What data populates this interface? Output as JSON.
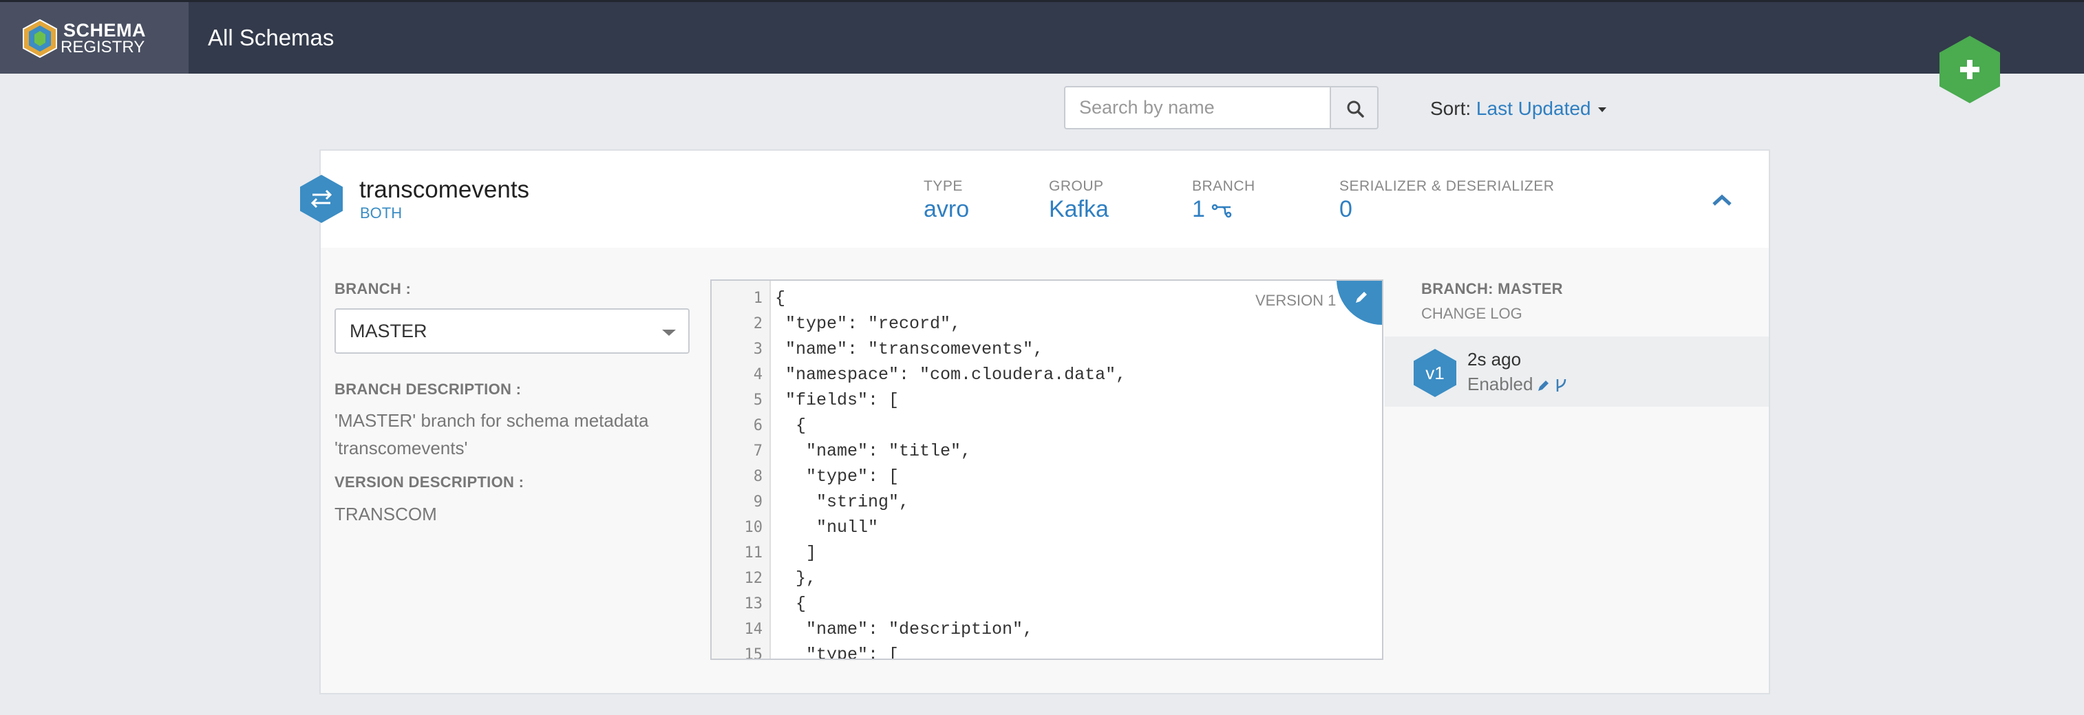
{
  "app": {
    "brand_line1": "SCHEMA",
    "brand_line2": "REGISTRY",
    "page_title": "All Schemas"
  },
  "colors": {
    "topbar": "#333a4b",
    "accent": "#3b8dc4",
    "add_button": "#4aab4f"
  },
  "search": {
    "placeholder": "Search by name",
    "value": ""
  },
  "sort": {
    "label": "Sort:",
    "value": "Last Updated"
  },
  "schema": {
    "name": "transcomevents",
    "compatibility": "BOTH",
    "type_label": "TYPE",
    "type_value": "avro",
    "group_label": "GROUP",
    "group_value": "Kafka",
    "branch_label": "BRANCH",
    "branch_value": "1",
    "serdes_label": "SERIALIZER & DESERIALIZER",
    "serdes_value": "0"
  },
  "left_panel": {
    "branch_label": "BRANCH :",
    "branch_selected": "MASTER",
    "branch_desc_label": "BRANCH DESCRIPTION :",
    "branch_desc": "'MASTER' branch for schema metadata 'transcomevents'",
    "version_desc_label": "VERSION DESCRIPTION :",
    "version_desc": "TRANSCOM"
  },
  "editor": {
    "version_label": "VERSION 1",
    "lines": [
      {
        "n": "1",
        "text": "{"
      },
      {
        "n": "2",
        "text": " \"type\": \"record\","
      },
      {
        "n": "3",
        "text": " \"name\": \"transcomevents\","
      },
      {
        "n": "4",
        "text": " \"namespace\": \"com.cloudera.data\","
      },
      {
        "n": "5",
        "text": " \"fields\": ["
      },
      {
        "n": "6",
        "text": "  {"
      },
      {
        "n": "7",
        "text": "   \"name\": \"title\","
      },
      {
        "n": "8",
        "text": "   \"type\": ["
      },
      {
        "n": "9",
        "text": "    \"string\","
      },
      {
        "n": "10",
        "text": "    \"null\""
      },
      {
        "n": "11",
        "text": "   ]"
      },
      {
        "n": "12",
        "text": "  },"
      },
      {
        "n": "13",
        "text": "  {"
      },
      {
        "n": "14",
        "text": "   \"name\": \"description\","
      },
      {
        "n": "15",
        "text": "   \"type\": ["
      }
    ]
  },
  "right_panel": {
    "branch_title": "BRANCH: MASTER",
    "changelog_label": "CHANGE LOG",
    "entry": {
      "version": "v1",
      "time": "2s ago",
      "status": "Enabled"
    }
  }
}
